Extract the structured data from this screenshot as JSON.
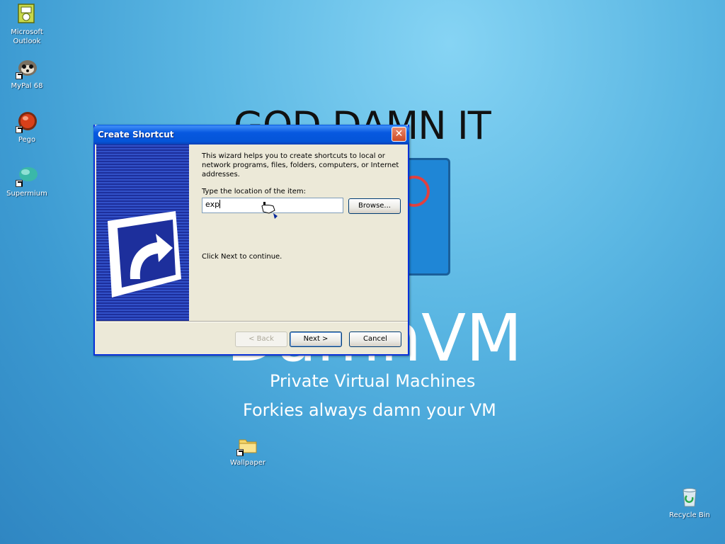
{
  "wallpaper": {
    "headline": "GOD DAMN IT",
    "logo_text": "DamnVM",
    "subtitle_1": "Private Virtual Machines",
    "subtitle_2": "Forkies always damn your VM"
  },
  "desktop_icons": [
    {
      "label_line1": "Microsoft",
      "label_line2": "Outlook",
      "icon": "outlook-icon"
    },
    {
      "label_line1": "MyPal 68",
      "label_line2": "",
      "icon": "mypal-icon"
    },
    {
      "label_line1": "Pego",
      "label_line2": "",
      "icon": "pego-icon"
    },
    {
      "label_line1": "Supermium",
      "label_line2": "",
      "icon": "supermium-icon"
    },
    {
      "label_line1": "Wallpaper",
      "label_line2": "",
      "icon": "folder-icon"
    },
    {
      "label_line1": "Recycle Bin",
      "label_line2": "",
      "icon": "recycle-bin-icon"
    }
  ],
  "dialog": {
    "title": "Create Shortcut",
    "close_glyph": "✕",
    "intro": "This wizard helps you to create shortcuts to local or network programs, files, folders, computers, or Internet addresses.",
    "location_label": "Type the location of the item:",
    "location_value": "exp",
    "browse_label": "Browse...",
    "continue_text": "Click Next to continue.",
    "back_label": "< Back",
    "next_label": "Next >",
    "cancel_label": "Cancel"
  },
  "colors": {
    "titlebar": "#0758e0",
    "dialog_bg": "#ece9d8",
    "close_button": "#cf4a24",
    "desktop": "#3d9bd2"
  }
}
